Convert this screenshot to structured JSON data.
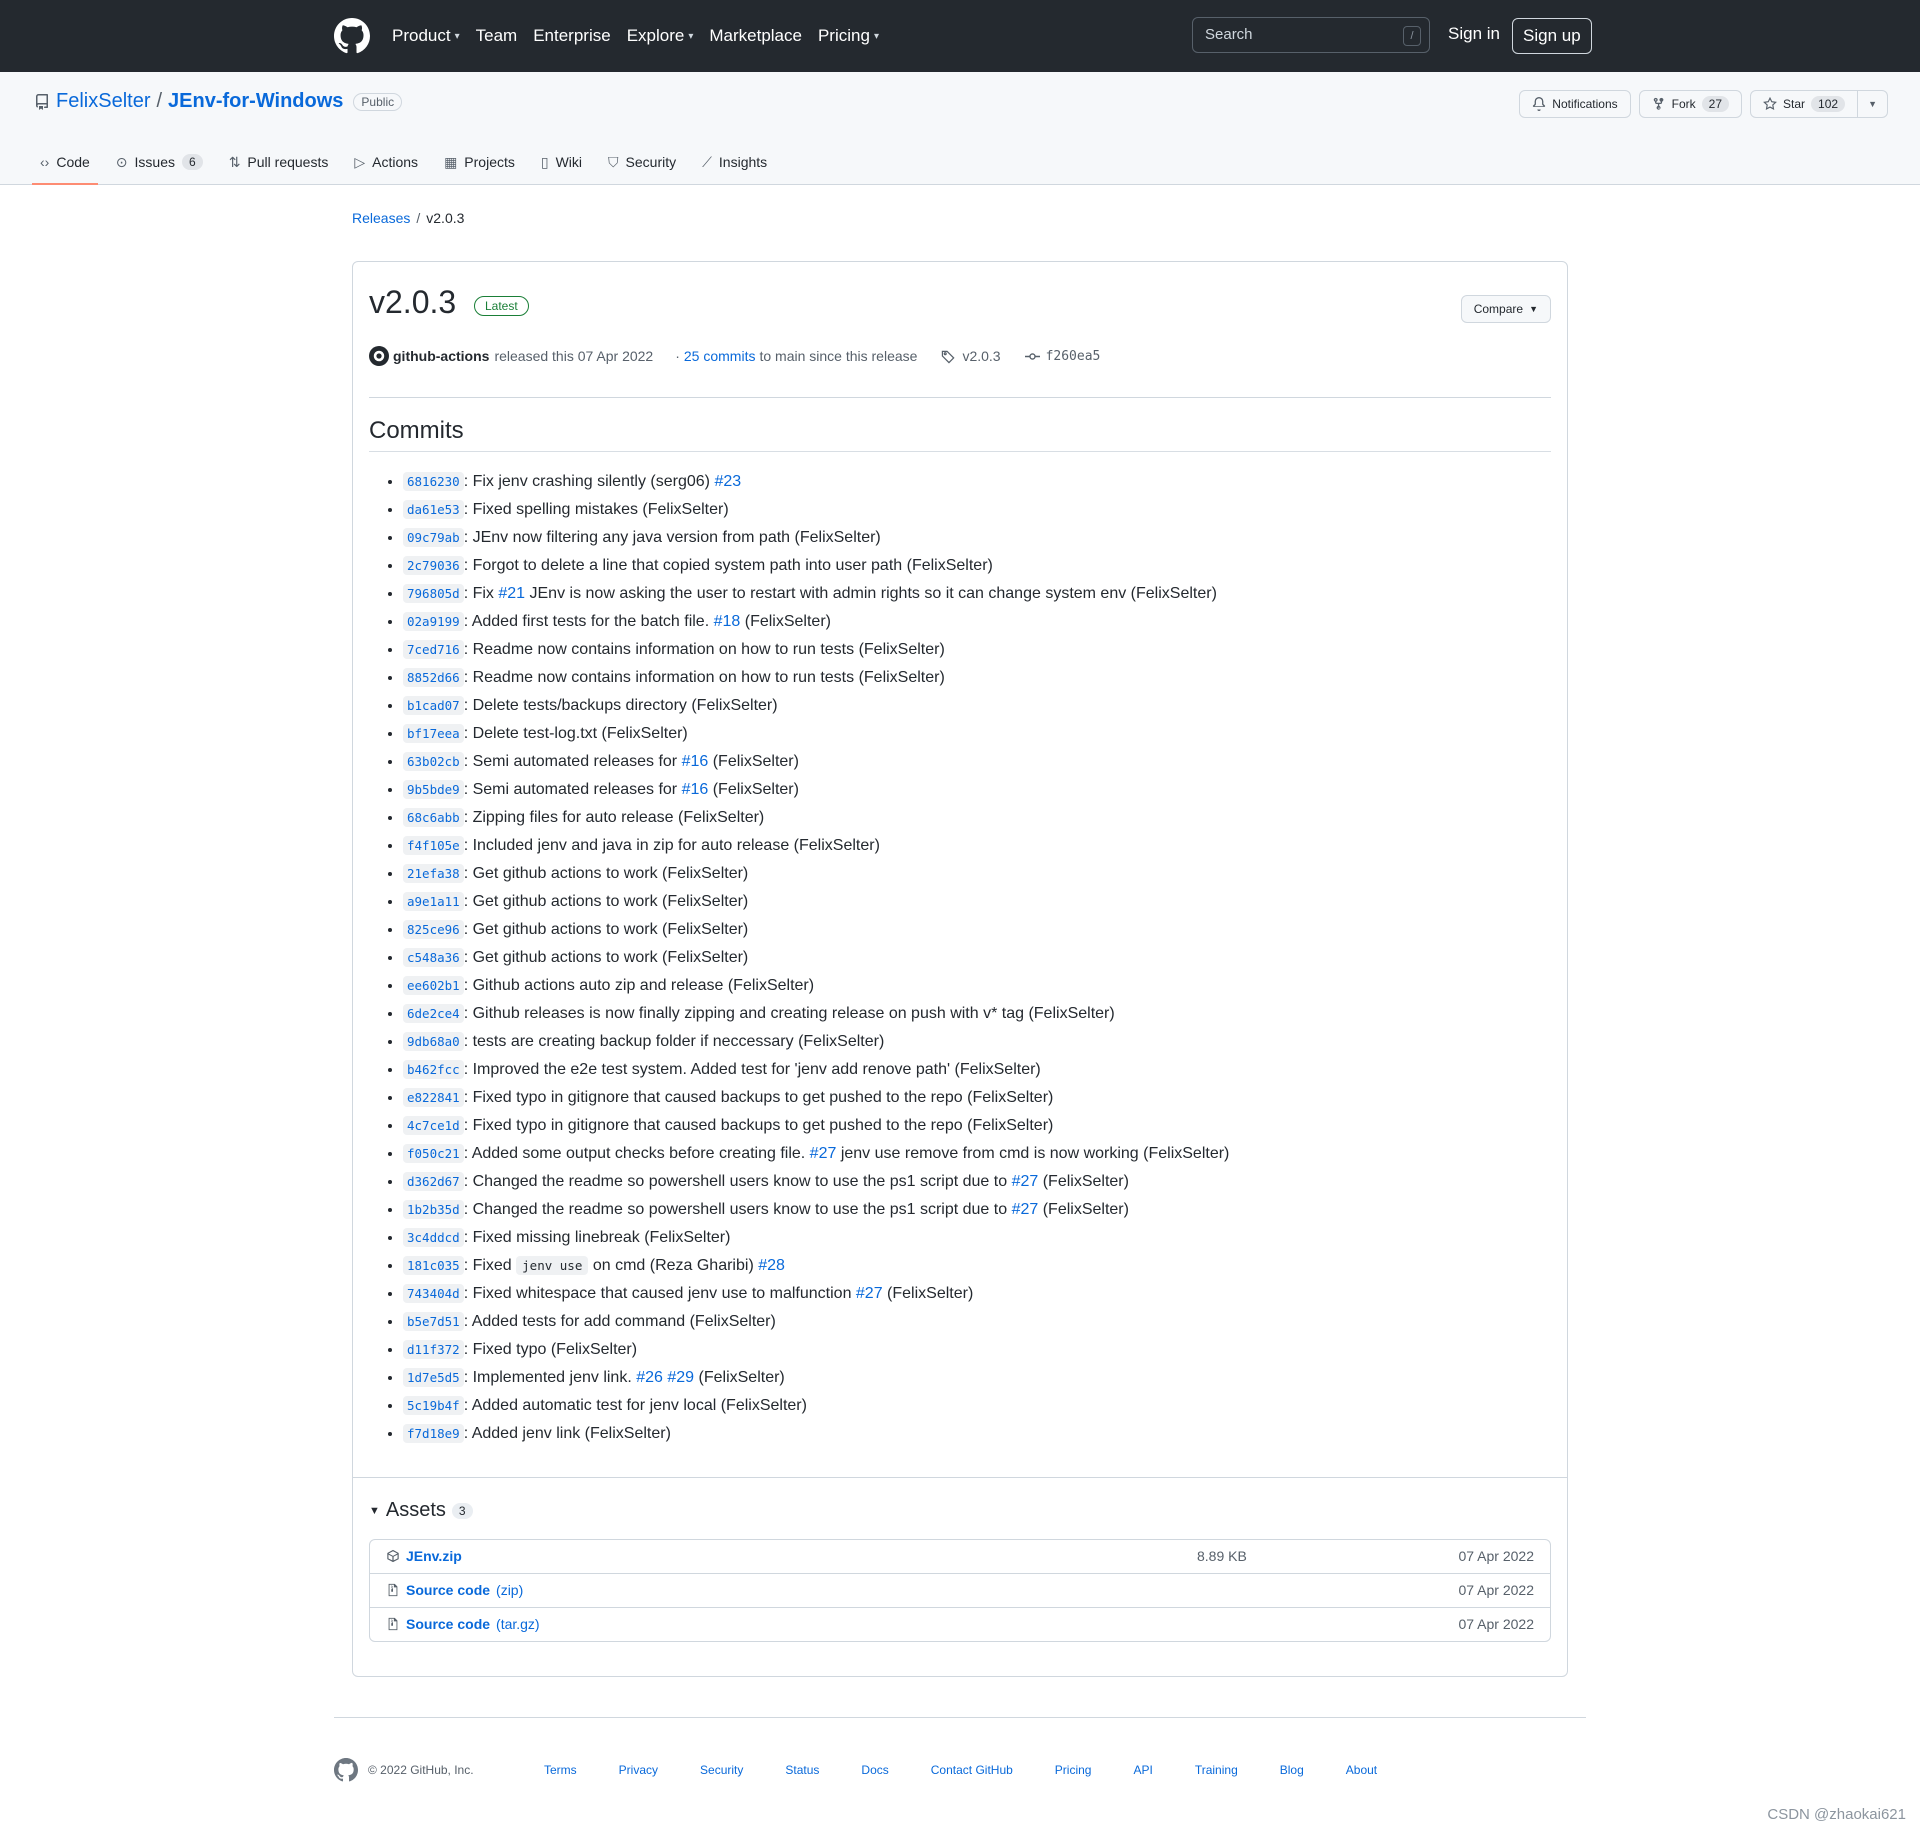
{
  "header": {
    "nav": [
      {
        "label": "Product",
        "dropdown": true
      },
      {
        "label": "Team",
        "dropdown": false
      },
      {
        "label": "Enterprise",
        "dropdown": false
      },
      {
        "label": "Explore",
        "dropdown": true
      },
      {
        "label": "Marketplace",
        "dropdown": false
      },
      {
        "label": "Pricing",
        "dropdown": true
      }
    ],
    "search_placeholder": "Search",
    "search_shortcut": "/",
    "sign_in": "Sign in",
    "sign_up": "Sign up"
  },
  "repo": {
    "owner": "FelixSelter",
    "separator": "/",
    "name": "JEnv-for-Windows",
    "visibility": "Public",
    "notifications_label": "Notifications",
    "fork_label": "Fork",
    "fork_count": "27",
    "star_label": "Star",
    "star_count": "102",
    "tabs": [
      {
        "label": "Code",
        "icon": "code-icon",
        "active": true,
        "count": ""
      },
      {
        "label": "Issues",
        "icon": "issue-icon",
        "active": false,
        "count": "6"
      },
      {
        "label": "Pull requests",
        "icon": "pull-request-icon",
        "active": false,
        "count": ""
      },
      {
        "label": "Actions",
        "icon": "play-icon",
        "active": false,
        "count": ""
      },
      {
        "label": "Projects",
        "icon": "table-icon",
        "active": false,
        "count": ""
      },
      {
        "label": "Wiki",
        "icon": "book-icon",
        "active": false,
        "count": ""
      },
      {
        "label": "Security",
        "icon": "shield-icon",
        "active": false,
        "count": ""
      },
      {
        "label": "Insights",
        "icon": "graph-icon",
        "active": false,
        "count": ""
      }
    ]
  },
  "breadcrumb": {
    "root": "Releases",
    "separator": "/",
    "current": "v2.0.3"
  },
  "release": {
    "title": "v2.0.3",
    "badge": "Latest",
    "compare_label": "Compare",
    "author": "github-actions",
    "released_text": "released this 07 Apr 2022",
    "commits_prefix": "·",
    "commits_link": "25 commits",
    "commits_suffix": "to main since this release",
    "tag": "v2.0.3",
    "commit": "f260ea5",
    "commits_heading": "Commits",
    "commits": [
      {
        "sha": "6816230",
        "parts": [
          {
            "t": ": Fix jenv crashing silently (serg06) "
          },
          {
            "link": "#23"
          }
        ]
      },
      {
        "sha": "da61e53",
        "parts": [
          {
            "t": ": Fixed spelling mistakes (FelixSelter)"
          }
        ]
      },
      {
        "sha": "09c79ab",
        "parts": [
          {
            "t": ": JEnv now filtering any java version from path (FelixSelter)"
          }
        ]
      },
      {
        "sha": "2c79036",
        "parts": [
          {
            "t": ": Forgot to delete a line that copied system path into user path (FelixSelter)"
          }
        ]
      },
      {
        "sha": "796805d",
        "parts": [
          {
            "t": ": Fix "
          },
          {
            "link": "#21"
          },
          {
            "t": " JEnv is now asking the user to restart with admin rights so it can change system env (FelixSelter)"
          }
        ]
      },
      {
        "sha": "02a9199",
        "parts": [
          {
            "t": ": Added first tests for the batch file. "
          },
          {
            "link": "#18"
          },
          {
            "t": " (FelixSelter)"
          }
        ]
      },
      {
        "sha": "7ced716",
        "parts": [
          {
            "t": ": Readme now contains information on how to run tests (FelixSelter)"
          }
        ]
      },
      {
        "sha": "8852d66",
        "parts": [
          {
            "t": ": Readme now contains information on how to run tests (FelixSelter)"
          }
        ]
      },
      {
        "sha": "b1cad07",
        "parts": [
          {
            "t": ": Delete tests/backups directory (FelixSelter)"
          }
        ]
      },
      {
        "sha": "bf17eea",
        "parts": [
          {
            "t": ": Delete test-log.txt (FelixSelter)"
          }
        ]
      },
      {
        "sha": "63b02cb",
        "parts": [
          {
            "t": ": Semi automated releases for "
          },
          {
            "link": "#16"
          },
          {
            "t": " (FelixSelter)"
          }
        ]
      },
      {
        "sha": "9b5bde9",
        "parts": [
          {
            "t": ": Semi automated releases for "
          },
          {
            "link": "#16"
          },
          {
            "t": " (FelixSelter)"
          }
        ]
      },
      {
        "sha": "68c6abb",
        "parts": [
          {
            "t": ": Zipping files for auto release (FelixSelter)"
          }
        ]
      },
      {
        "sha": "f4f105e",
        "parts": [
          {
            "t": ": Included jenv and java in zip for auto release (FelixSelter)"
          }
        ]
      },
      {
        "sha": "21efa38",
        "parts": [
          {
            "t": ": Get github actions to work (FelixSelter)"
          }
        ]
      },
      {
        "sha": "a9e1a11",
        "parts": [
          {
            "t": ": Get github actions to work (FelixSelter)"
          }
        ]
      },
      {
        "sha": "825ce96",
        "parts": [
          {
            "t": ": Get github actions to work (FelixSelter)"
          }
        ]
      },
      {
        "sha": "c548a36",
        "parts": [
          {
            "t": ": Get github actions to work (FelixSelter)"
          }
        ]
      },
      {
        "sha": "ee602b1",
        "parts": [
          {
            "t": ": Github actions auto zip and release (FelixSelter)"
          }
        ]
      },
      {
        "sha": "6de2ce4",
        "parts": [
          {
            "t": ": Github releases is now finally zipping and creating release on push with v* tag (FelixSelter)"
          }
        ]
      },
      {
        "sha": "9db68a0",
        "parts": [
          {
            "t": ": tests are creating backup folder if neccessary (FelixSelter)"
          }
        ]
      },
      {
        "sha": "b462fcc",
        "parts": [
          {
            "t": ": Improved the e2e test system. Added test for 'jenv add renove path' (FelixSelter)"
          }
        ]
      },
      {
        "sha": "e822841",
        "parts": [
          {
            "t": ": Fixed typo in gitignore that caused backups to get pushed to the repo (FelixSelter)"
          }
        ]
      },
      {
        "sha": "4c7ce1d",
        "parts": [
          {
            "t": ": Fixed typo in gitignore that caused backups to get pushed to the repo (FelixSelter)"
          }
        ]
      },
      {
        "sha": "f050c21",
        "parts": [
          {
            "t": ": Added some output checks before creating file. "
          },
          {
            "link": "#27"
          },
          {
            "t": " jenv use remove from cmd is now working (FelixSelter)"
          }
        ]
      },
      {
        "sha": "d362d67",
        "parts": [
          {
            "t": ": Changed the readme so powershell users know to use the ps1 script due to "
          },
          {
            "link": "#27"
          },
          {
            "t": " (FelixSelter)"
          }
        ]
      },
      {
        "sha": "1b2b35d",
        "parts": [
          {
            "t": ": Changed the readme so powershell users know to use the ps1 script due to "
          },
          {
            "link": "#27"
          },
          {
            "t": " (FelixSelter)"
          }
        ]
      },
      {
        "sha": "3c4ddcd",
        "parts": [
          {
            "t": ": Fixed missing linebreak (FelixSelter)"
          }
        ]
      },
      {
        "sha": "181c035",
        "parts": [
          {
            "t": ": Fixed "
          },
          {
            "code": "jenv use"
          },
          {
            "t": " on cmd (Reza Gharibi) "
          },
          {
            "link": "#28"
          }
        ]
      },
      {
        "sha": "743404d",
        "parts": [
          {
            "t": ": Fixed whitespace that caused jenv use to malfunction "
          },
          {
            "link": "#27"
          },
          {
            "t": " (FelixSelter)"
          }
        ]
      },
      {
        "sha": "b5e7d51",
        "parts": [
          {
            "t": ": Added tests for add command (FelixSelter)"
          }
        ]
      },
      {
        "sha": "d11f372",
        "parts": [
          {
            "t": ": Fixed typo (FelixSelter)"
          }
        ]
      },
      {
        "sha": "1d7e5d5",
        "parts": [
          {
            "t": ": Implemented jenv link. "
          },
          {
            "link": "#26"
          },
          {
            "t": " "
          },
          {
            "link": "#29"
          },
          {
            "t": " (FelixSelter)"
          }
        ]
      },
      {
        "sha": "5c19b4f",
        "parts": [
          {
            "t": ": Added automatic test for jenv local (FelixSelter)"
          }
        ]
      },
      {
        "sha": "f7d18e9",
        "parts": [
          {
            "t": ": Added jenv link (FelixSelter)"
          }
        ]
      }
    ],
    "assets_heading": "Assets",
    "assets_count": "3",
    "assets": [
      {
        "name": "JEnv.zip",
        "ext": "",
        "size": "8.89 KB",
        "date": "07 Apr 2022",
        "icon": "package-icon"
      },
      {
        "name": "Source code",
        "ext": "(zip)",
        "size": "",
        "date": "07 Apr 2022",
        "icon": "file-zip-icon"
      },
      {
        "name": "Source code",
        "ext": "(tar.gz)",
        "size": "",
        "date": "07 Apr 2022",
        "icon": "file-zip-icon"
      }
    ]
  },
  "footer": {
    "copyright": "© 2022 GitHub, Inc.",
    "links": [
      "Terms",
      "Privacy",
      "Security",
      "Status",
      "Docs",
      "Contact GitHub",
      "Pricing",
      "API",
      "Training",
      "Blog",
      "About"
    ]
  },
  "watermark": "CSDN @zhaokai621",
  "colors": {
    "header_bg": "#24292f",
    "link": "#0969da",
    "latest_green": "#1a7f37",
    "tab_underline": "#fd8c73"
  }
}
